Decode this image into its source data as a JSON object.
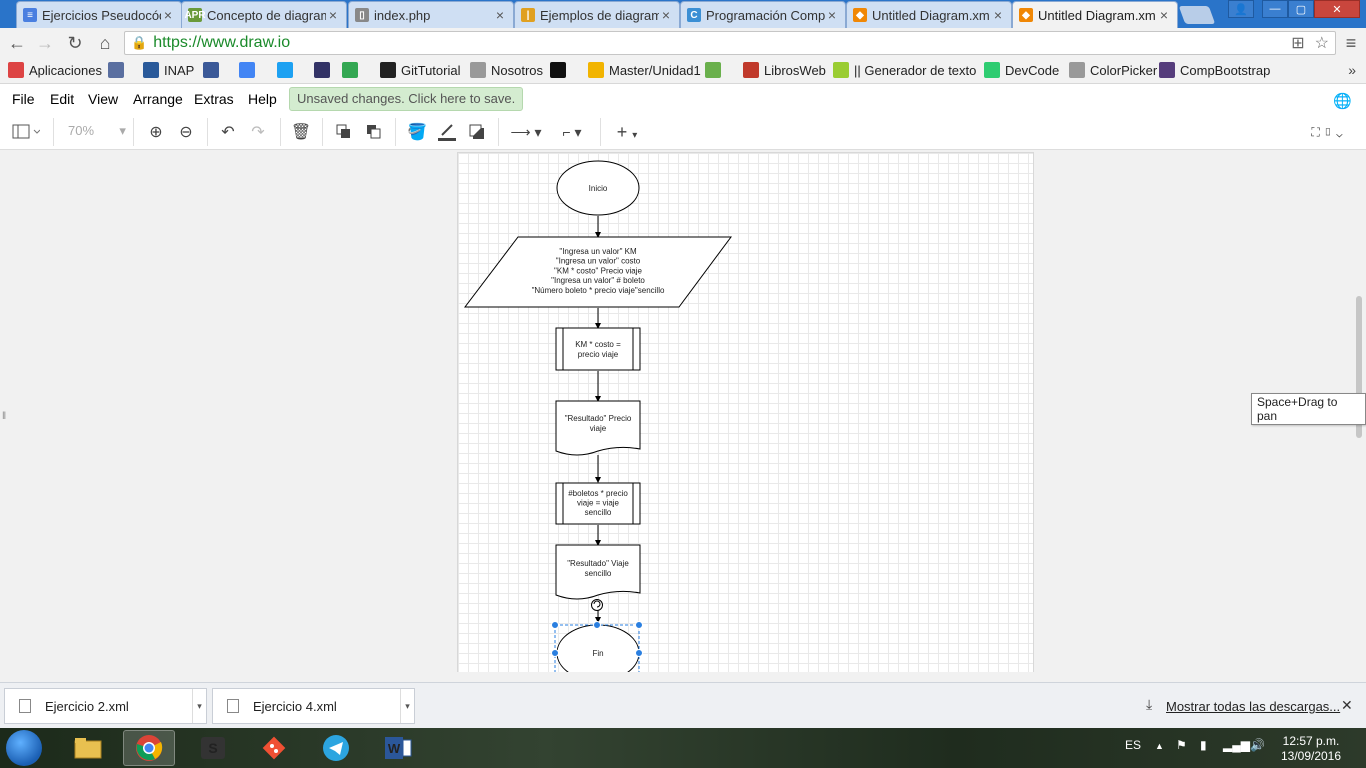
{
  "browser": {
    "tabs": [
      {
        "title": "Ejercicios Pseudocód",
        "icon": "google-docs-icon",
        "color": "#4a7fe0",
        "glyph": "≡"
      },
      {
        "title": "Concepto de diagram",
        "icon": "apr-icon",
        "color": "#6a9a3a",
        "glyph": "APR"
      },
      {
        "title": "index.php",
        "icon": "page-icon",
        "color": "#888888",
        "glyph": "▯"
      },
      {
        "title": "Ejemplos de diagram",
        "icon": "pencil-icon",
        "color": "#e0a020",
        "glyph": "|"
      },
      {
        "title": "Programación Comp",
        "icon": "caty-icon",
        "color": "#3b8fd4",
        "glyph": "C"
      },
      {
        "title": "Untitled Diagram.xm",
        "icon": "drawio-icon",
        "color": "#f08705",
        "glyph": "◆"
      },
      {
        "title": "Untitled Diagram.xm",
        "icon": "drawio-icon",
        "color": "#f08705",
        "glyph": "◆"
      }
    ],
    "active_tab": 6,
    "url": "https://www.draw.io",
    "bookmarks": [
      {
        "label": "Aplicaciones",
        "icon": "apps-grid-icon",
        "color": "#d44"
      },
      {
        "label": "",
        "icon": "seal-icon",
        "color": "#5a6fa0"
      },
      {
        "label": "INAP",
        "icon": "inap-icon",
        "color": "#2a5a9a"
      },
      {
        "label": "",
        "icon": "facebook-icon",
        "color": "#3b5998"
      },
      {
        "label": "",
        "icon": "translate-icon",
        "color": "#4285f4"
      },
      {
        "label": "",
        "icon": "twitter-icon",
        "color": "#1da1f2"
      },
      {
        "label": "",
        "icon": "code-icon",
        "color": "#333366"
      },
      {
        "label": "",
        "icon": "maps-icon",
        "color": "#34a853"
      },
      {
        "label": "GitTutorial",
        "icon": "octocat-icon",
        "color": "#222222"
      },
      {
        "label": "Nosotros",
        "icon": "page-icon",
        "color": "#999999"
      },
      {
        "label": "",
        "icon": "github-icon",
        "color": "#111111"
      },
      {
        "label": "Master/Unidad1",
        "icon": "folder-icon",
        "color": "#f2b400"
      },
      {
        "label": "",
        "icon": "w3-icon",
        "color": "#6ab04c"
      },
      {
        "label": "LibrosWeb",
        "icon": "book-icon",
        "color": "#c0392b"
      },
      {
        "label": "|| Generador de texto",
        "icon": "lorem-icon",
        "color": "#9acd32"
      },
      {
        "label": "DevCode",
        "icon": "devcode-icon",
        "color": "#2ecc71"
      },
      {
        "label": "ColorPicker",
        "icon": "page-icon",
        "color": "#999999"
      },
      {
        "label": "CompBootstrap",
        "icon": "bootstrap-icon",
        "color": "#563d7c"
      }
    ]
  },
  "app": {
    "menus": [
      "File",
      "Edit",
      "View",
      "Arrange",
      "Extras",
      "Help"
    ],
    "unsaved_notice": "Unsaved changes. Click here to save.",
    "zoom": "70%",
    "tooltip": "Space+Drag to pan"
  },
  "diagram": {
    "start": "Inicio",
    "input_lines": [
      "\"Ingresa un valor\" KM",
      "\"Ingresa un valor\" costo",
      "\"KM * costo\" Precio viaje",
      "\"Ingresa un valor\" # boleto",
      "\"Número boleto * precio viaje\"sencillo"
    ],
    "process1_lines": [
      "KM * costo =",
      "precio viaje"
    ],
    "output1_lines": [
      "\"Resultado\" Precio",
      "viaje"
    ],
    "process2_lines": [
      "#boletos * precio",
      "viaje = viaje",
      "sencillo"
    ],
    "output2_lines": [
      "\"Resultado\" Viaje",
      "sencillo"
    ],
    "end": "Fin"
  },
  "downloads": {
    "items": [
      "Ejercicio 2.xml",
      "Ejercicio 4.xml"
    ],
    "show_all": "Mostrar todas las descargas...",
    "close": "✕"
  },
  "taskbar": {
    "lang": "ES",
    "time": "12:57 p.m.",
    "date": "13/09/2016"
  }
}
